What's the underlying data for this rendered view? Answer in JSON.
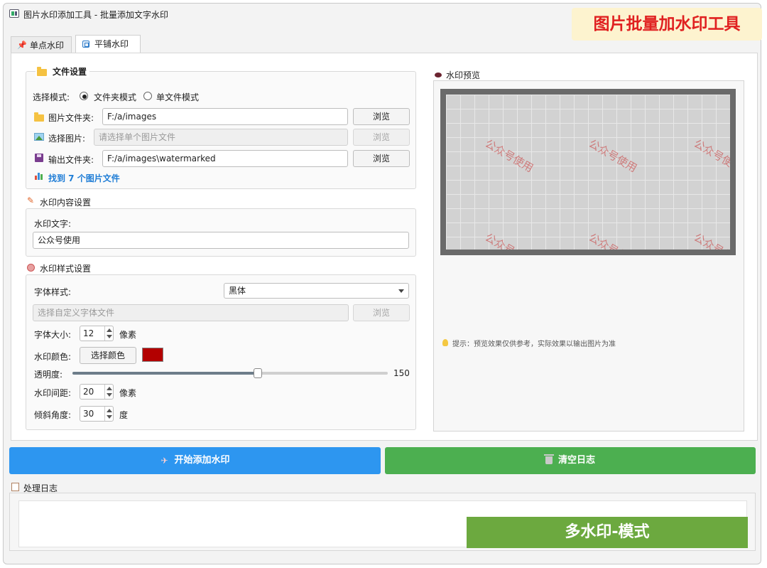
{
  "window": {
    "title": "图片水印添加工具 - 批量添加文字水印"
  },
  "banner": {
    "text": "图片批量加水印工具"
  },
  "tabs": [
    {
      "label": "单点水印",
      "icon": "pin-icon"
    },
    {
      "label": "平铺水印",
      "icon": "tile-icon",
      "active": true
    }
  ],
  "file_settings": {
    "title": "文件设置",
    "mode_label": "选择模式:",
    "modes": [
      {
        "label": "文件夹模式",
        "checked": true
      },
      {
        "label": "单文件模式",
        "checked": false
      }
    ],
    "image_folder": {
      "label": "图片文件夹:",
      "value": "F:/a/images",
      "browse": "浏览"
    },
    "select_image": {
      "label": "选择图片:",
      "placeholder": "请选择单个图片文件",
      "browse": "浏览"
    },
    "output_folder": {
      "label": "输出文件夹:",
      "value": "F:/a/images\\watermarked",
      "browse": "浏览"
    },
    "found": "找到 7 个图片文件"
  },
  "content_settings": {
    "title": "水印内容设置",
    "text_label": "水印文字:",
    "text_value": "公众号使用"
  },
  "style_settings": {
    "title": "水印样式设置",
    "font_style_label": "字体样式:",
    "font_style_value": "黑体",
    "custom_font_placeholder": "选择自定义字体文件",
    "custom_font_browse": "浏览",
    "font_size_label": "字体大小:",
    "font_size_value": "12",
    "font_size_unit": "像素",
    "color_label": "水印颜色:",
    "color_button": "选择颜色",
    "color_value": "#b30000",
    "opacity_label": "透明度:",
    "opacity_value": "150",
    "opacity_max": 255,
    "spacing_label": "水印间距:",
    "spacing_value": "20",
    "spacing_unit": "像素",
    "angle_label": "倾斜角度:",
    "angle_value": "30",
    "angle_unit": "度"
  },
  "preview": {
    "title": "水印预览",
    "watermark_text": "公众号使用",
    "tip": "提示：预览效果仅供参考，实际效果以输出图片为准"
  },
  "actions": {
    "start": "开始添加水印",
    "clear": "清空日志"
  },
  "log": {
    "title": "处理日志"
  },
  "mode_banner": {
    "text": "多水印-模式"
  },
  "colors": {
    "accent_blue": "#2d96f0",
    "accent_green": "#4caf50",
    "banner_red": "#e02020",
    "mode_green": "#6ca93f"
  }
}
